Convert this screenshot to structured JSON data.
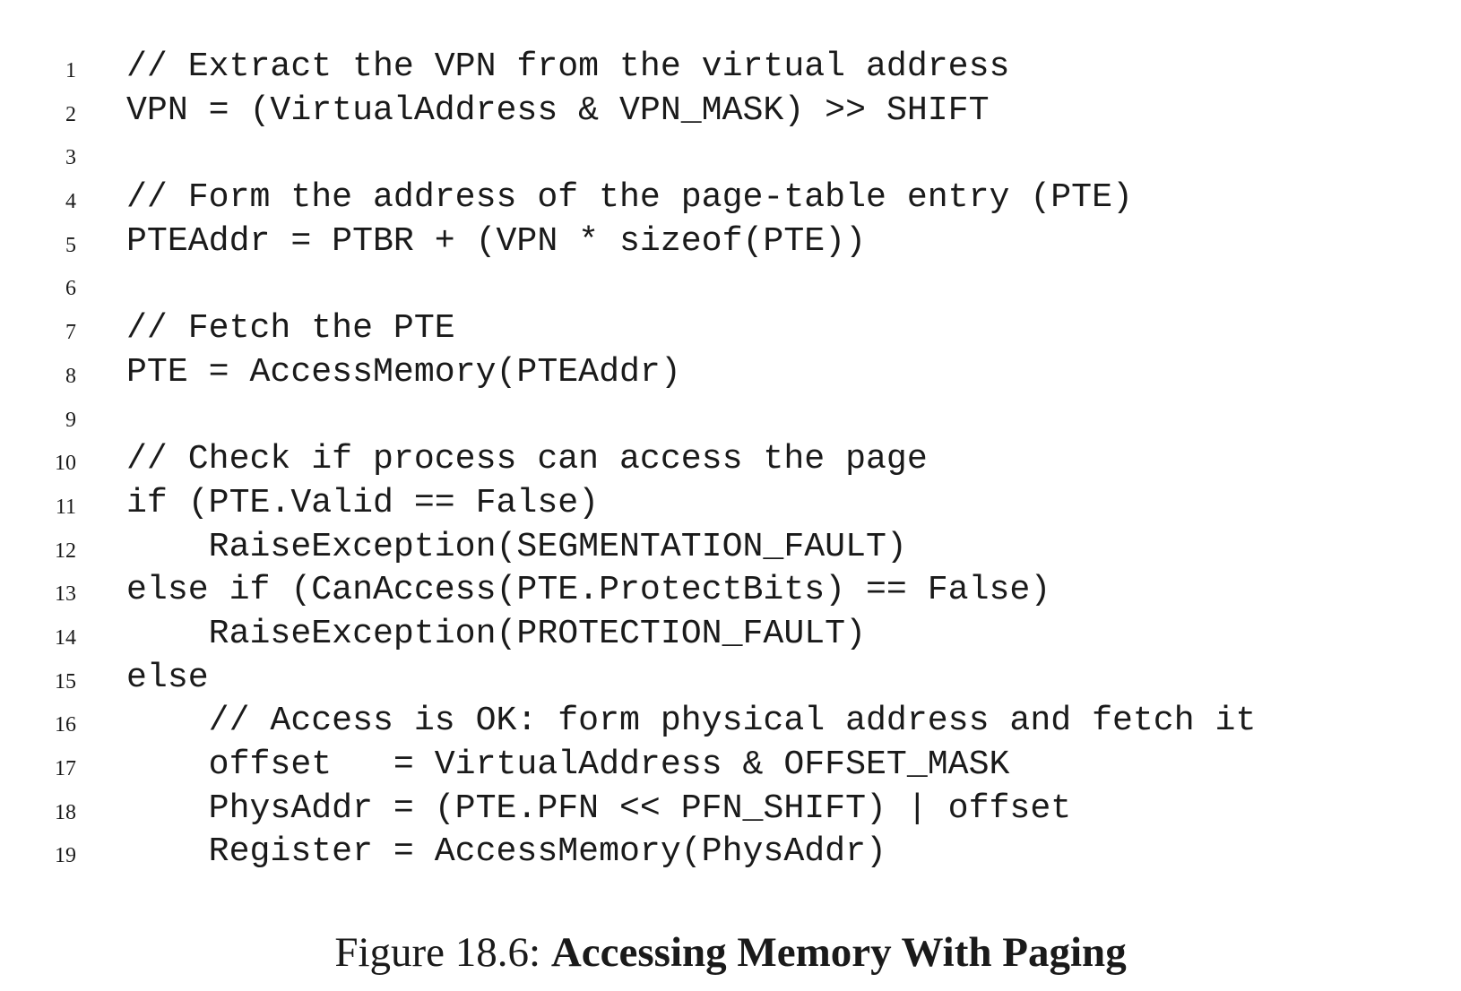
{
  "listing": {
    "lines": [
      {
        "number": "1",
        "code": "// Extract the VPN from the virtual address"
      },
      {
        "number": "2",
        "code": "VPN = (VirtualAddress & VPN_MASK) >> SHIFT"
      },
      {
        "number": "3",
        "code": ""
      },
      {
        "number": "4",
        "code": "// Form the address of the page-table entry (PTE)"
      },
      {
        "number": "5",
        "code": "PTEAddr = PTBR + (VPN * sizeof(PTE))"
      },
      {
        "number": "6",
        "code": ""
      },
      {
        "number": "7",
        "code": "// Fetch the PTE"
      },
      {
        "number": "8",
        "code": "PTE = AccessMemory(PTEAddr)"
      },
      {
        "number": "9",
        "code": ""
      },
      {
        "number": "10",
        "code": "// Check if process can access the page"
      },
      {
        "number": "11",
        "code": "if (PTE.Valid == False)"
      },
      {
        "number": "12",
        "code": "    RaiseException(SEGMENTATION_FAULT)"
      },
      {
        "number": "13",
        "code": "else if (CanAccess(PTE.ProtectBits) == False)"
      },
      {
        "number": "14",
        "code": "    RaiseException(PROTECTION_FAULT)"
      },
      {
        "number": "15",
        "code": "else"
      },
      {
        "number": "16",
        "code": "    // Access is OK: form physical address and fetch it"
      },
      {
        "number": "17",
        "code": "    offset   = VirtualAddress & OFFSET_MASK"
      },
      {
        "number": "18",
        "code": "    PhysAddr = (PTE.PFN << PFN_SHIFT) | offset"
      },
      {
        "number": "19",
        "code": "    Register = AccessMemory(PhysAddr)"
      }
    ]
  },
  "caption": {
    "label": "Figure 18.6:",
    "title": "Accessing Memory With Paging"
  }
}
